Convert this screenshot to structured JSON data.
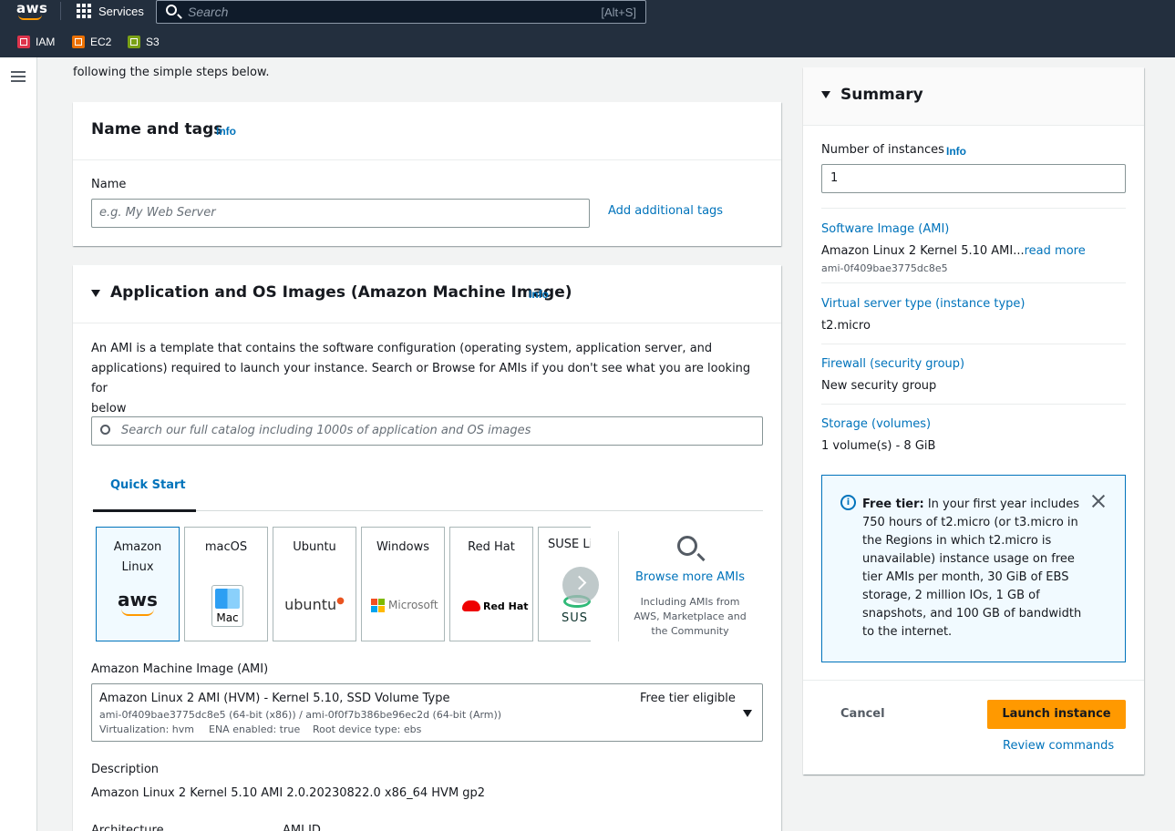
{
  "topnav": {
    "logo": "aws",
    "services_label": "Services",
    "search_placeholder": "Search",
    "search_shortcut": "[Alt+S]",
    "favorites": [
      {
        "label": "IAM",
        "color": "#dd344c"
      },
      {
        "label": "EC2",
        "color": "#ed7100"
      },
      {
        "label": "S3",
        "color": "#7aa116"
      }
    ]
  },
  "intro_text": "following the simple steps below.",
  "name_tags": {
    "title": "Name and tags",
    "info": "Info",
    "name_label": "Name",
    "name_placeholder": "e.g. My Web Server",
    "add_tags": "Add additional tags"
  },
  "ami_section": {
    "title": "Application and OS Images (Amazon Machine Image)",
    "info": "Info",
    "description_line1": "An AMI is a template that contains the software configuration (operating system, application server, and",
    "description_line2": "applications) required to launch your instance. Search or Browse for AMIs if you don't see what you are looking for",
    "description_line3": "below",
    "search_placeholder": "Search our full catalog including 1000s of application and OS images",
    "tab_quick_start": "Quick Start",
    "tiles": [
      {
        "name_line1": "Amazon",
        "name_line2": "Linux",
        "logo": "aws"
      },
      {
        "name_line1": "macOS",
        "name_line2": "",
        "logo": "Mac"
      },
      {
        "name_line1": "Ubuntu",
        "name_line2": "",
        "logo": "ubuntu"
      },
      {
        "name_line1": "Windows",
        "name_line2": "",
        "logo": "Microsoft"
      },
      {
        "name_line1": "Red Hat",
        "name_line2": "",
        "logo": "Red Hat"
      },
      {
        "name_line1": "SUSE Li",
        "name_line2": "",
        "logo": "SUS"
      }
    ],
    "browse_more": "Browse more AMIs",
    "browse_sub1": "Including AMIs from",
    "browse_sub2": "AWS, Marketplace and",
    "browse_sub3": "the Community",
    "ami_label": "Amazon Machine Image (AMI)",
    "ami_selected_title": "Amazon Linux 2 AMI (HVM) - Kernel 5.10, SSD Volume Type",
    "ami_selected_ids": "ami-0f409bae3775dc8e5 (64-bit (x86)) / ami-0f0f7b386be96ec2d (64-bit (Arm))",
    "ami_virtualization": "Virtualization: hvm",
    "ami_ena": "ENA enabled: true",
    "ami_root": "Root device type: ebs",
    "ami_free_tier": "Free tier eligible",
    "desc_label": "Description",
    "desc_value": "Amazon Linux 2 Kernel 5.10 AMI 2.0.20230822.0 x86_64 HVM gp2",
    "arch_label": "Architecture",
    "amiid_label": "AMI ID"
  },
  "summary": {
    "title": "Summary",
    "instances_label": "Number of instances",
    "instances_info": "Info",
    "instances_value": "1",
    "software_label": "Software Image (AMI)",
    "software_value": "Amazon Linux 2 Kernel 5.10 AMI...",
    "read_more": "read more",
    "software_id": "ami-0f409bae3775dc8e5",
    "instance_type_label": "Virtual server type (instance type)",
    "instance_type_value": "t2.micro",
    "firewall_label": "Firewall (security group)",
    "firewall_value": "New security group",
    "storage_label": "Storage (volumes)",
    "storage_value": "1 volume(s) - 8 GiB",
    "free_tier_bold": "Free tier:",
    "free_tier_lines": [
      " In your first year includes",
      "750 hours of t2.micro (or t3.micro in",
      "the Regions in which t2.micro is",
      "unavailable) instance usage on free",
      "tier AMIs per month, 30 GiB of EBS",
      "storage, 2 million IOs, 1 GB of",
      "snapshots, and 100 GB of bandwidth",
      "to the internet."
    ],
    "cancel": "Cancel",
    "launch": "Launch instance",
    "review": "Review commands"
  }
}
